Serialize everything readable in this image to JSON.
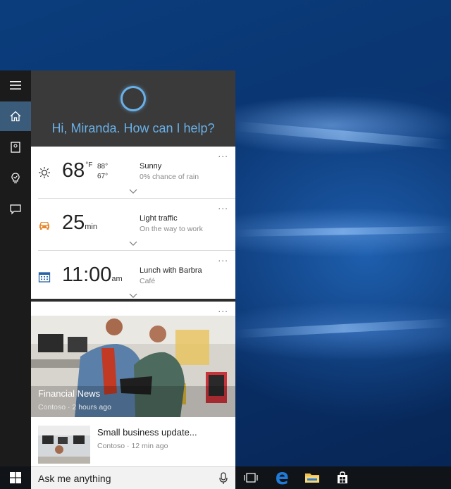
{
  "assistant": {
    "greeting": "Hi, Miranda. How can I help?"
  },
  "weather": {
    "temp": "68",
    "unit": "°F",
    "high": "88°",
    "low": "67°",
    "condition": "Sunny",
    "detail": "0% chance of rain",
    "more": "..."
  },
  "traffic": {
    "value": "25",
    "unit": "min",
    "condition": "Light traffic",
    "detail": "On the way to work",
    "more": "..."
  },
  "calendar": {
    "time": "11:00",
    "ampm": "am",
    "event": "Lunch with Barbra",
    "location": "Café",
    "more": "..."
  },
  "news": {
    "more": "...",
    "featured": {
      "category": "Financial News",
      "source": "Contoso",
      "age": "2 hours ago"
    },
    "item": {
      "title": "Small business update...",
      "source": "Contoso",
      "age": "12 min ago"
    },
    "separator": " · "
  },
  "taskbar": {
    "search_placeholder": "Ask me anything"
  },
  "colors": {
    "accent": "#6ab0e8",
    "rail_active": "#3b5b7a",
    "header_bg": "#3a3a3a"
  }
}
